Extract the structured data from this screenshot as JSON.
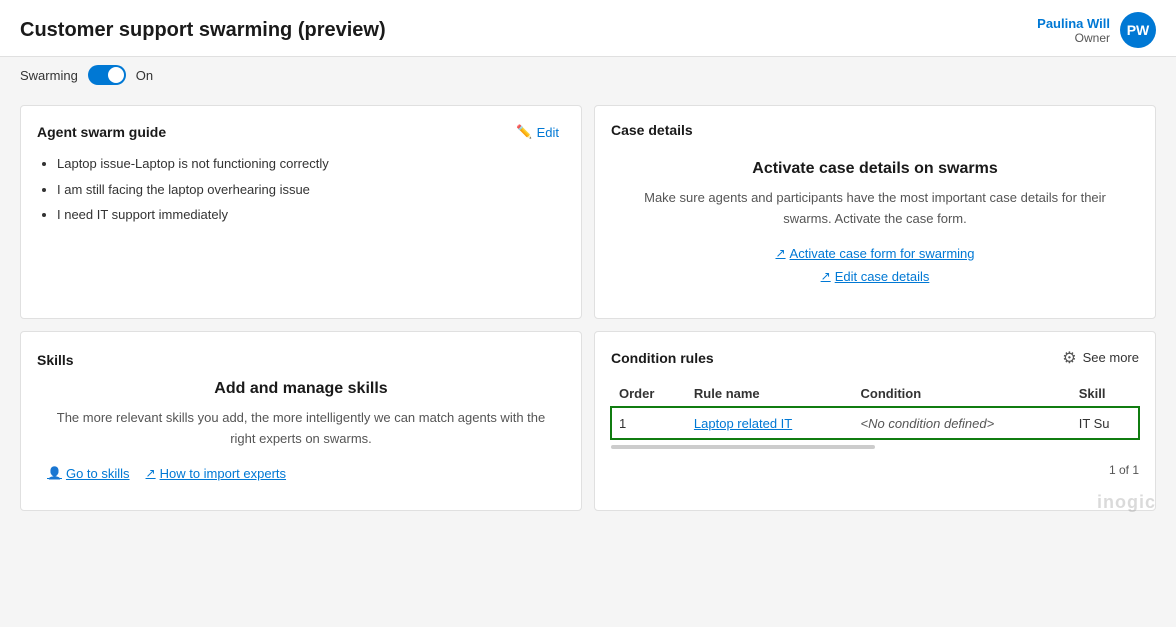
{
  "header": {
    "title": "Customer support swarming (preview)",
    "user": {
      "name": "Paulina Will",
      "role": "Owner",
      "initials": "PW"
    }
  },
  "swarming": {
    "label": "Swarming",
    "toggle_state": "On"
  },
  "agent_swarm_guide": {
    "title": "Agent swarm guide",
    "edit_label": "Edit",
    "items": [
      "Laptop issue-Laptop is not functioning correctly",
      "I am still facing the laptop overhearing issue",
      "I need IT support immediately"
    ]
  },
  "case_details": {
    "title": "Case details",
    "activate_title": "Activate case details on swarms",
    "description": "Make sure agents and participants have the most important case details for their swarms. Activate the case form.",
    "activate_link": "Activate case form for swarming",
    "edit_link": "Edit case details"
  },
  "skills": {
    "title": "Skills",
    "manage_title": "Add and manage skills",
    "description": "The more relevant skills you add, the more intelligently we can match agents with the right experts on swarms.",
    "go_to_skills": "Go to skills",
    "how_to_import": "How to import experts"
  },
  "condition_rules": {
    "title": "Condition rules",
    "see_more_label": "See more",
    "columns": {
      "order": "Order",
      "rule_name": "Rule name",
      "condition": "Condition",
      "skill": "Skill"
    },
    "rows": [
      {
        "order": "1",
        "rule_name": "Laptop related IT",
        "condition": "<No condition defined>",
        "skill": "IT Su"
      }
    ],
    "pagination": "1 of 1"
  },
  "watermark": "inogic"
}
